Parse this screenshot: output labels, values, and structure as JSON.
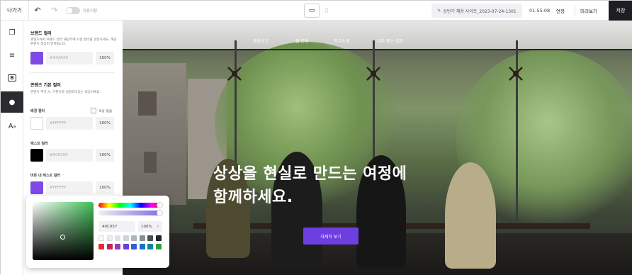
{
  "topbar": {
    "exit_label": "나가기",
    "undo_icon": "undo-icon",
    "redo_icon": "redo-icon",
    "autosave_label": "자동저장",
    "filename": "상반기 채용 사이트_2023-07-24-1301",
    "time": "01:55:08",
    "extend_label": "연장",
    "preview_label": "미리보기",
    "save_label": "저장"
  },
  "rail": {
    "items": [
      "pages-icon",
      "sections-icon",
      "blocks-icon",
      "color-icon",
      "typography-icon"
    ],
    "active": "color-icon"
  },
  "panel": {
    "brand_title": "브랜드 컬러",
    "brand_desc": "콘텐츠에서 브랜드 컬러 해당부에 쓰실 컬러를 설정하세요. 해당 콘텐츠 색상이 변경됩니다.",
    "brand_hex": "#343A40",
    "brand_pct": "100%",
    "brand_color": "#7e4ae6",
    "content_title": "콘텐츠 기본 컬러",
    "content_desc": "콘텐츠 추가 시, 기본으로 설정되어있는 색상이에요.",
    "bg_label": "배경 컬러",
    "no_bg_label": "색상 없음",
    "bg_hex": "#FFFFFF",
    "bg_pct": "100%",
    "text_label": "텍스트 컬러",
    "text_hex": "#000000",
    "text_pct": "100%",
    "btn_text_label": "버튼 내 텍스트 컬러",
    "btn_text_hex": "#FFFFFF",
    "btn_text_pct": "100%",
    "btn_text_color": "#7e4ae6"
  },
  "hero": {
    "nav": [
      "채용공고",
      "팀 문화",
      "직무소개",
      "자주 묻는 질문"
    ],
    "headline_line1": "상상을 현실로 만드는 여정에",
    "headline_line2": "함께하세요.",
    "cta_label": "자세히 보기",
    "cta_color": "#6d3ee0"
  },
  "picker": {
    "hex": "40C057",
    "pct": "100%",
    "base_color": "#40c057",
    "swatches_row1": [
      "#f8f9fa",
      "#e9ecef",
      "#dee2e6",
      "#ced4da",
      "#adb5bd",
      "#868e96",
      "#495057",
      "#212529"
    ],
    "swatches_row2": [
      "#e03131",
      "#c2255c",
      "#9c36b5",
      "#6741d9",
      "#3b5bdb",
      "#1971c2",
      "#0c8599",
      "#2f9e44"
    ]
  }
}
